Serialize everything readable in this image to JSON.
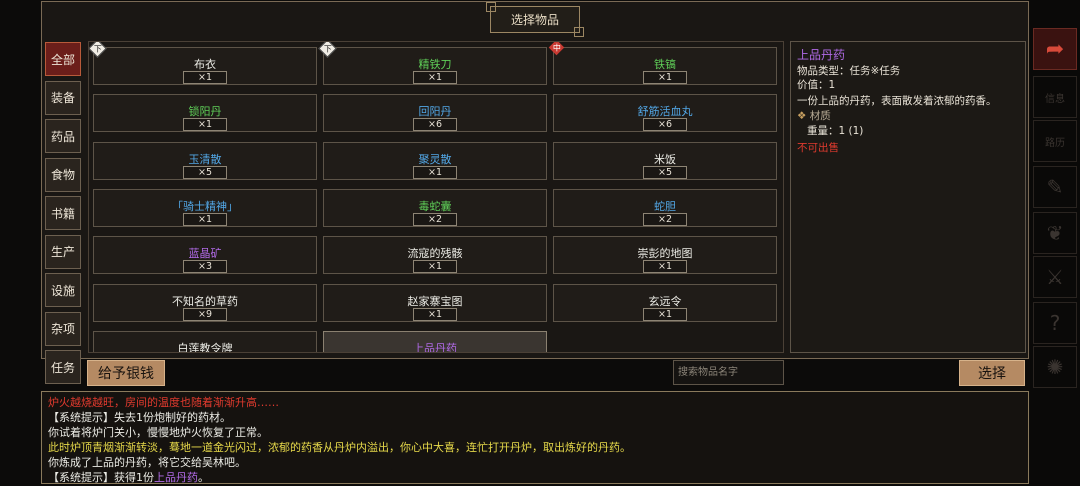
{
  "window": {
    "title": "选择物品"
  },
  "categories": [
    {
      "label": "全部",
      "active": true
    },
    {
      "label": "装备",
      "active": false
    },
    {
      "label": "药品",
      "active": false
    },
    {
      "label": "食物",
      "active": false
    },
    {
      "label": "书籍",
      "active": false
    },
    {
      "label": "生产",
      "active": false
    },
    {
      "label": "设施",
      "active": false
    },
    {
      "label": "杂项",
      "active": false
    },
    {
      "label": "任务",
      "active": false
    }
  ],
  "items": [
    {
      "name": "布衣",
      "qty": "×1",
      "color": "#ecece6",
      "tag": "下"
    },
    {
      "name": "精铁刀",
      "qty": "×1",
      "color": "#5fcf58",
      "tag": "下"
    },
    {
      "name": "铁镐",
      "qty": "×1",
      "color": "#5fcf58",
      "tag": "中"
    },
    {
      "name": "锁阳丹",
      "qty": "×1",
      "color": "#5fcf58",
      "tag": ""
    },
    {
      "name": "回阳丹",
      "qty": "×6",
      "color": "#52a7e6",
      "tag": ""
    },
    {
      "name": "舒筋活血丸",
      "qty": "×6",
      "color": "#52a7e6",
      "tag": ""
    },
    {
      "name": "玉清散",
      "qty": "×5",
      "color": "#52a7e6",
      "tag": ""
    },
    {
      "name": "聚灵散",
      "qty": "×1",
      "color": "#52a7e6",
      "tag": ""
    },
    {
      "name": "米饭",
      "qty": "×5",
      "color": "#ecece6",
      "tag": ""
    },
    {
      "name": "「骑士精神」",
      "qty": "×1",
      "color": "#52a7e6",
      "tag": ""
    },
    {
      "name": "毒蛇囊",
      "qty": "×2",
      "color": "#5fcf58",
      "tag": ""
    },
    {
      "name": "蛇胆",
      "qty": "×2",
      "color": "#52a7e6",
      "tag": ""
    },
    {
      "name": "蓝晶矿",
      "qty": "×3",
      "color": "#b06ae6",
      "tag": ""
    },
    {
      "name": "流寇的残骸",
      "qty": "×1",
      "color": "#ecece6",
      "tag": ""
    },
    {
      "name": "崇彭的地图",
      "qty": "×1",
      "color": "#ecece6",
      "tag": ""
    },
    {
      "name": "不知名的草药",
      "qty": "×9",
      "color": "#ecece6",
      "tag": ""
    },
    {
      "name": "赵家寨宝图",
      "qty": "×1",
      "color": "#ecece6",
      "tag": ""
    },
    {
      "name": "玄远令",
      "qty": "×1",
      "color": "#ecece6",
      "tag": ""
    },
    {
      "name": "白莲教令牌",
      "qty": "",
      "color": "#ecece6",
      "tag": ""
    },
    {
      "name": "上品丹药",
      "qty": "",
      "color": "#b06ae6",
      "tag": "",
      "selected": true
    }
  ],
  "detail": {
    "name": "上品丹药",
    "type": "物品类型：任务※任务",
    "price": "价值：1",
    "desc": "一份上品的丹药，表面散发着浓郁的药香。",
    "material_header": "材质",
    "weight": "重量：1 (1)",
    "not_for_sale": "不可出售"
  },
  "actions": {
    "give_money": "给予银钱",
    "search_placeholder": "搜索物品名字",
    "select": "选择"
  },
  "log": [
    {
      "text": "炉火越烧越旺，房间的温度也随着渐渐升高……",
      "color": "#e03a2e"
    },
    {
      "text": "【系统提示】失去1份炮制好的药材。",
      "color": "#ecece6"
    },
    {
      "text": "你试着将炉门关小，慢慢地炉火恢复了正常。",
      "color": "#ecece6"
    },
    {
      "text": "此时炉顶青烟渐渐转淡，蓦地一道金光闪过，浓郁的药香从丹炉内溢出，你心中大喜，连忙打开丹炉，取出炼好的丹药。",
      "color": "#e6d94a"
    },
    {
      "text": "你炼成了上品的丹药，将它交给吴林吧。",
      "color": "#ecece6"
    },
    {
      "text_prefix": "【系统提示】获得1份",
      "item": "上品丹药",
      "text_suffix": "。",
      "color": "#ecece6",
      "item_color": "#b06ae6"
    }
  ],
  "right_rail": {
    "info_label": "信息",
    "chain_label": "路历"
  }
}
